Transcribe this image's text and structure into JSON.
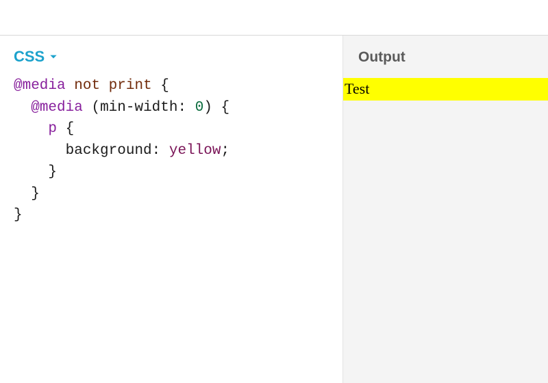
{
  "editor": {
    "language_label": "CSS",
    "code": {
      "l1": {
        "at": "@media",
        "kw1": "not",
        "kw2": "print",
        "brace": "{"
      },
      "l2": {
        "at": "@media",
        "paren_open": "(",
        "cond": "min-width",
        "colon": ":",
        "num": "0",
        "paren_close": ")",
        "brace": "{"
      },
      "l3": {
        "sel": "p",
        "brace": "{"
      },
      "l4": {
        "prop": "background",
        "colon": ":",
        "val": "yellow",
        "semi": ";"
      },
      "l5": {
        "brace": "}"
      },
      "l6": {
        "brace": "}"
      },
      "l7": {
        "brace": "}"
      }
    }
  },
  "output": {
    "header": "Output",
    "text": "Test",
    "background_color": "#ffff00"
  }
}
